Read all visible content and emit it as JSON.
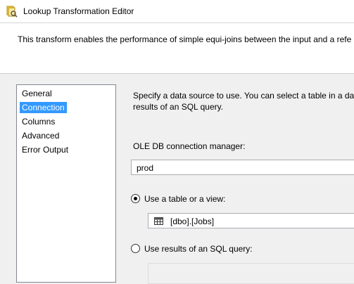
{
  "window": {
    "title": "Lookup Transformation Editor",
    "icon": "lookup-transform-icon"
  },
  "banner": {
    "text": "This transform enables the performance of simple equi-joins between the input and a refe"
  },
  "nav": {
    "items": [
      {
        "label": "General",
        "selected": false
      },
      {
        "label": "Connection",
        "selected": true
      },
      {
        "label": "Columns",
        "selected": false
      },
      {
        "label": "Advanced",
        "selected": false
      },
      {
        "label": "Error Output",
        "selected": false
      }
    ],
    "selected_color": "#3399ff"
  },
  "connection": {
    "description_line1": "Specify a data source to use. You can select a table in a data",
    "description_line2": "results of an SQL query.",
    "connection_manager_label": "OLE DB connection manager:",
    "connection_manager_value": "prod",
    "options": {
      "use_table": {
        "label": "Use a table or a view:",
        "selected": true
      },
      "use_sql": {
        "label": "Use results of an SQL query:",
        "selected": false
      }
    },
    "table_value": "[dbo].[Jobs]",
    "table_icon": "table-grid-icon"
  }
}
